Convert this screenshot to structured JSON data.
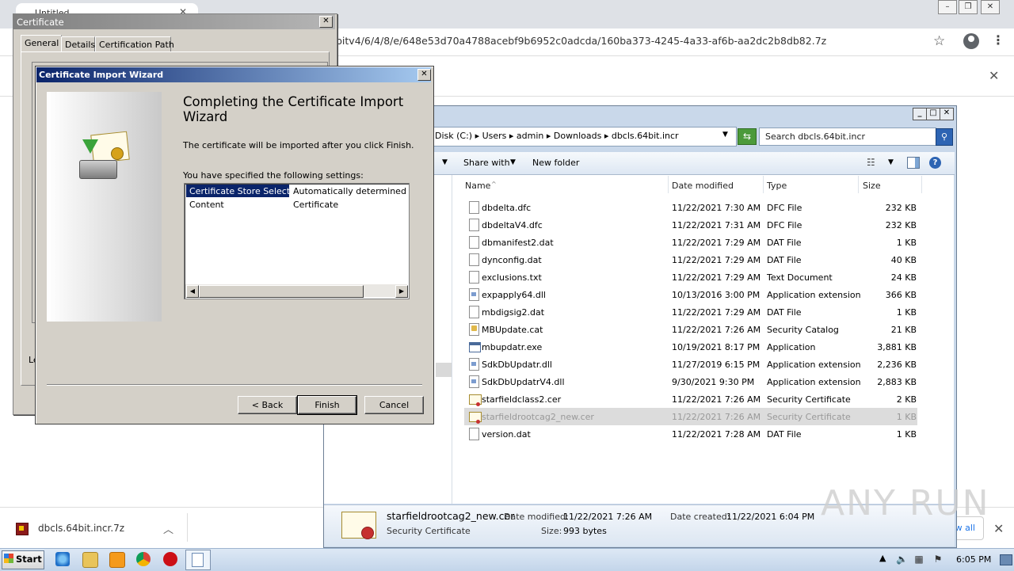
{
  "browser": {
    "tab_title": "Untitled",
    "url": "bitv4/6/4/8/e/648e53d70a4788acebf9b6952c0adcda/160ba373-4245-4a33-af6b-aa2dc2b8db82.7z",
    "download_filename": "dbcls.64bit.incr.7z",
    "show_all_label": "w all"
  },
  "explorer": {
    "breadcrumb": "Disk (C:)  ▸  Users  ▸  admin  ▸  Downloads  ▸  dbcls.64bit.incr",
    "search_placeholder": "Search dbcls.64bit.incr",
    "toolbar": {
      "share_with": "Share with",
      "new_folder": "New folder"
    },
    "columns": {
      "name": "Name",
      "date": "Date modified",
      "type": "Type",
      "size": "Size"
    },
    "files": [
      {
        "name": "dbdelta.dfc",
        "date": "11/22/2021 7:30 AM",
        "type": "DFC File",
        "size": "232 KB",
        "icon": "file"
      },
      {
        "name": "dbdeltaV4.dfc",
        "date": "11/22/2021 7:31 AM",
        "type": "DFC File",
        "size": "232 KB",
        "icon": "file"
      },
      {
        "name": "dbmanifest2.dat",
        "date": "11/22/2021 7:29 AM",
        "type": "DAT File",
        "size": "1 KB",
        "icon": "file"
      },
      {
        "name": "dynconfig.dat",
        "date": "11/22/2021 7:29 AM",
        "type": "DAT File",
        "size": "40 KB",
        "icon": "file"
      },
      {
        "name": "exclusions.txt",
        "date": "11/22/2021 7:29 AM",
        "type": "Text Document",
        "size": "24 KB",
        "icon": "file"
      },
      {
        "name": "expapply64.dll",
        "date": "10/13/2016 3:00 PM",
        "type": "Application extension",
        "size": "366 KB",
        "icon": "dll"
      },
      {
        "name": "mbdigsig2.dat",
        "date": "11/22/2021 7:29 AM",
        "type": "DAT File",
        "size": "1 KB",
        "icon": "file"
      },
      {
        "name": "MBUpdate.cat",
        "date": "11/22/2021 7:26 AM",
        "type": "Security Catalog",
        "size": "21 KB",
        "icon": "cat"
      },
      {
        "name": "mbupdatr.exe",
        "date": "10/19/2021 8:17 PM",
        "type": "Application",
        "size": "3,881 KB",
        "icon": "exe"
      },
      {
        "name": "SdkDbUpdatr.dll",
        "date": "11/27/2019 6:15 PM",
        "type": "Application extension",
        "size": "2,236 KB",
        "icon": "dll"
      },
      {
        "name": "SdkDbUpdatrV4.dll",
        "date": "9/30/2021 9:30 PM",
        "type": "Application extension",
        "size": "2,883 KB",
        "icon": "dll"
      },
      {
        "name": "starfieldclass2.cer",
        "date": "11/22/2021 7:26 AM",
        "type": "Security Certificate",
        "size": "2 KB",
        "icon": "cer"
      },
      {
        "name": "starfieldrootcag2_new.cer",
        "date": "11/22/2021 7:26 AM",
        "type": "Security Certificate",
        "size": "1 KB",
        "icon": "cer",
        "selected": true
      },
      {
        "name": "version.dat",
        "date": "11/22/2021 7:28 AM",
        "type": "DAT File",
        "size": "1 KB",
        "icon": "file"
      }
    ],
    "details": {
      "name": "starfieldrootcag2_new.cer",
      "type": "Security Certificate",
      "modified_label": "Date modified:",
      "modified_value": "11/22/2021 7:26 AM",
      "size_label": "Size:",
      "size_value": "993 bytes",
      "created_label": "Date created:",
      "created_value": "11/22/2021 6:04 PM"
    }
  },
  "certificate": {
    "title": "Certificate",
    "tabs": [
      "General",
      "Details",
      "Certification Path"
    ],
    "partial_label": "Le"
  },
  "wizard": {
    "title": "Certificate Import Wizard",
    "heading": "Completing the Certificate Import Wizard",
    "description": "The certificate will be imported after you click Finish.",
    "settings_label": "You have specified the following settings:",
    "settings": [
      {
        "key": "Certificate Store Selected",
        "value": "Automatically determined by the wizard"
      },
      {
        "key": "Content",
        "value": "Certificate"
      }
    ],
    "buttons": {
      "back": "< Back",
      "finish": "Finish",
      "cancel": "Cancel"
    }
  },
  "taskbar": {
    "start_label": "Start",
    "time": "6:05 PM"
  },
  "watermark": "ANY RUN"
}
